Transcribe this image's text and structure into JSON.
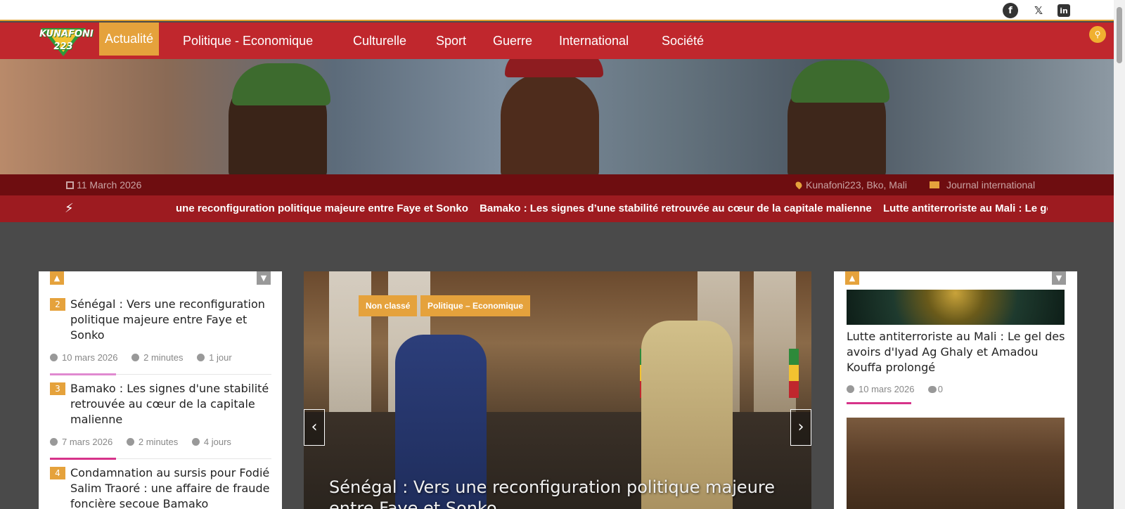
{
  "social": {
    "facebook": "f",
    "x": "𝕏",
    "linkedin": "in"
  },
  "nav": {
    "logo": "KUNAFONI 223",
    "items": [
      "Actualité",
      "Politique - Economique",
      "Culturelle",
      "Sport",
      "Guerre",
      "International",
      "Société"
    ],
    "active_index": 0
  },
  "infobar": {
    "date": "11 March 2026",
    "location": "Kunafoni223, Bko, Mali",
    "journal": "Journal international"
  },
  "ticker": {
    "items": [
      "une reconfiguration politique majeure entre Faye et Sonko",
      "Bamako : Les signes d’une stabilité retrouvée au cœur de la capitale malienne",
      "Lutte antiterroriste au Mali : Le gel des avoirs d’I"
    ]
  },
  "left_posts": [
    {
      "num": "2",
      "title": "Sénégal : Vers une reconfiguration politique majeure entre Faye et Sonko",
      "date": "10 mars 2026",
      "read": "2 minutes",
      "ago": "1 jour",
      "accent": "#e08ad0"
    },
    {
      "num": "3",
      "title": "Bamako : Les signes d'une stabilité retrouvée au cœur de la capitale malienne",
      "date": "7 mars 2026",
      "read": "2 minutes",
      "ago": "4 jours",
      "accent": "#d6338a"
    },
    {
      "num": "4",
      "title": "Condamnation au sursis pour Fodié Salim Traoré : une affaire de fraude foncière secoue Bamako"
    }
  ],
  "slider": {
    "tags": [
      "Non classé",
      "Politique – Economique"
    ],
    "title": "Sénégal : Vers une reconfiguration politique majeure entre Faye et Sonko",
    "prev": "‹",
    "next": "›"
  },
  "right_post": {
    "title": "Lutte antiterroriste au Mali : Le gel des avoirs d'Iyad Ag Ghaly et Amadou Kouffa prolongé",
    "date": "10 mars 2026",
    "comments": "0"
  },
  "colors": {
    "nav_red": "#c0272d",
    "accent_orange": "#e5a23c",
    "info_dark": "#6e0d10",
    "ticker_red": "#9d1b20",
    "pink_accent": "#d6338a"
  }
}
